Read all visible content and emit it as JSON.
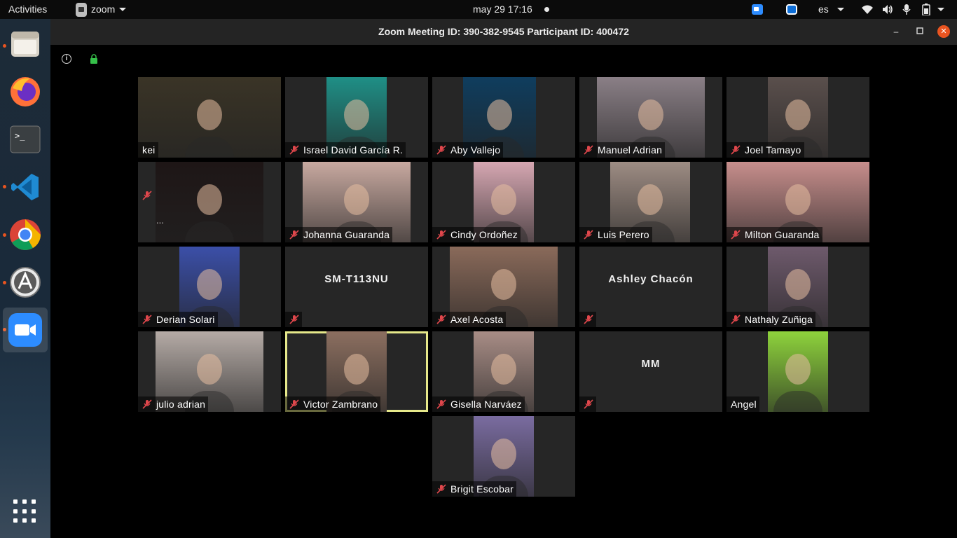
{
  "topbar": {
    "activities": "Activities",
    "app_name": "zoom",
    "clock": "may 29  17:16",
    "language": "es",
    "icons": [
      "zoom-tray-icon",
      "teamviewer-tray-icon",
      "wifi-icon",
      "volume-icon",
      "mic-icon",
      "battery-icon"
    ]
  },
  "dock": {
    "items": [
      "files",
      "firefox",
      "terminal",
      "vscode",
      "chrome",
      "software-center",
      "zoom",
      "show-applications"
    ]
  },
  "window": {
    "title": "Zoom Meeting ID: 390-382-9545 Participant ID: 400472",
    "controls": [
      "minimize",
      "maximize",
      "close"
    ]
  },
  "colors": {
    "active_speaker_border": "#e6e88a",
    "mute_icon": "#e0474c",
    "tile_background": "#262626",
    "close_button": "#e95420"
  },
  "participants": [
    {
      "name": "kei",
      "muted": false,
      "video": "#3a3426"
    },
    {
      "name": "Israel David García R.",
      "muted": true,
      "video": "#1f8f86"
    },
    {
      "name": "Aby Vallejo",
      "muted": true,
      "video": "#0f3d5e"
    },
    {
      "name": "Manuel Adrian",
      "muted": true,
      "video": "#8a7f86"
    },
    {
      "name": "Joel Tamayo",
      "muted": true,
      "video": "#5a4f4c"
    },
    {
      "name": "",
      "muted": true,
      "video": "#1e1616",
      "extra": "..."
    },
    {
      "name": "Johanna Guaranda",
      "muted": true,
      "video": "#c8a9a0"
    },
    {
      "name": "Cindy Ordoñez",
      "muted": true,
      "video": "#d6a7b2"
    },
    {
      "name": "Luis Perero",
      "muted": true,
      "video": "#9d8c83"
    },
    {
      "name": "Milton Guaranda",
      "muted": true,
      "video": "#c78e8c"
    },
    {
      "name": "Derian Solari",
      "muted": true,
      "video": "#3b4fa8"
    },
    {
      "name": "",
      "muted": true,
      "center_name": "SM-T113NU"
    },
    {
      "name": "Axel Acosta",
      "muted": true,
      "video": "#8a6a5a"
    },
    {
      "name": "",
      "muted": true,
      "center_name": "Ashley Chacón"
    },
    {
      "name": "Nathaly Zuñiga",
      "muted": true,
      "video": "#6e5a6c"
    },
    {
      "name": "julio adrian",
      "muted": true,
      "video": "#b5aba6"
    },
    {
      "name": "Victor Zambrano",
      "muted": true,
      "video": "#8c6f60",
      "active": true
    },
    {
      "name": "Gisella Narváez",
      "muted": true,
      "video": "#a88d86"
    },
    {
      "name": "",
      "muted": true,
      "center_name": "MM"
    },
    {
      "name": "Angel",
      "muted": false,
      "video": "#8ed33c"
    },
    {
      "name": "Brigit Escobar",
      "muted": true,
      "video": "#7a6ca0"
    }
  ]
}
